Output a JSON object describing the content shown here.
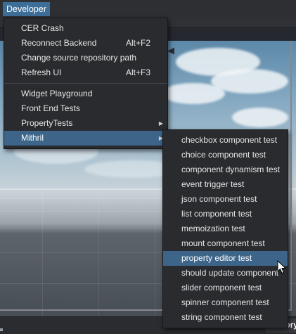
{
  "menubar": {
    "menu_title": "Developer"
  },
  "developer_menu": {
    "groups": [
      [
        {
          "label": "CER Crash"
        },
        {
          "label": "Reconnect Backend",
          "shortcut": "Alt+F2"
        },
        {
          "label": "Change source repository path"
        },
        {
          "label": "Refresh UI",
          "shortcut": "Alt+F3"
        }
      ],
      [
        {
          "label": "Widget Playground"
        },
        {
          "label": "Front End Tests"
        },
        {
          "label": "PropertyTests",
          "submenu": true
        },
        {
          "label": "Mithril",
          "submenu": true,
          "highlighted": true
        }
      ]
    ]
  },
  "mithril_menu": {
    "items": [
      {
        "label": "checkbox component test"
      },
      {
        "label": "choice component test"
      },
      {
        "label": "component dynamism test"
      },
      {
        "label": "event trigger test"
      },
      {
        "label": "json component test"
      },
      {
        "label": "list component test"
      },
      {
        "label": "memoization test"
      },
      {
        "label": "mount component test"
      },
      {
        "label": "property editor test",
        "highlighted": true
      },
      {
        "label": "should update component"
      },
      {
        "label": "slider component test"
      },
      {
        "label": "spinner component test"
      },
      {
        "label": "string component test"
      }
    ]
  },
  "statusbar": {
    "history_tab": "History"
  },
  "colors": {
    "highlight": "#3c6589",
    "menu_bg": "#2a2b2e",
    "menubar_active": "#3d6e98"
  }
}
